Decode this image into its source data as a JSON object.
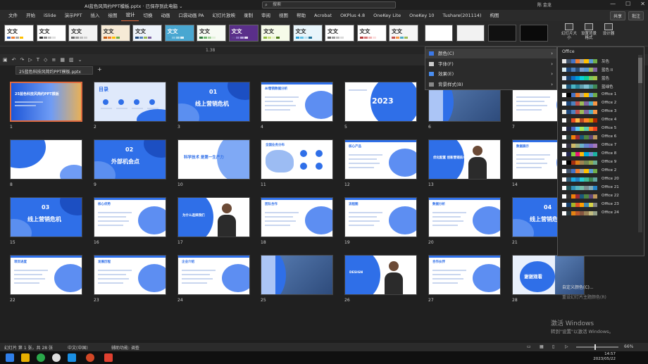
{
  "titlebar": {
    "title": "AI蓝色风简约PPT模板.pptx · 已保存到此电脑 ⌄",
    "search_placeholder": "搜索",
    "user": "陈 金龙",
    "min": "—",
    "max": "☐",
    "close": "✕"
  },
  "menu": {
    "items": [
      "文件",
      "开始",
      "iSlide",
      "演示PPT",
      "插入",
      "绘图",
      "设计",
      "切换",
      "动画",
      "口袋动画 PA",
      "幻灯片放映",
      "录制",
      "审阅",
      "视图",
      "帮助",
      "Acrobat",
      "OKPlus 4.8",
      "OneKey Lite",
      "OneKey 10",
      "Tushare(201114)",
      "构图"
    ],
    "active_index": 6,
    "share": "共享",
    "comment": "批注"
  },
  "ribbon": {
    "theme_label": "文文",
    "btn_size": "幻灯片大小",
    "btn_format": "设置背景格式",
    "btn_designer": "设计器"
  },
  "ruler": {
    "label": "1.38"
  },
  "doc_tab": "25蓝色科技风简约PPT模板.pptx",
  "theme_menu": {
    "items": [
      {
        "label": "颜色(C)",
        "color": "#3b78e7"
      },
      {
        "label": "字体(F)",
        "color": "#cccccc"
      },
      {
        "label": "效果(E)",
        "color": "#4a8ef0"
      },
      {
        "label": "背景样式(B)",
        "color": "#888888"
      }
    ]
  },
  "color_panel": {
    "header": "Office",
    "rows": [
      {
        "name": "灰色",
        "colors": [
          "#e7e6e6",
          "#44546a",
          "#4472c4",
          "#ed7d31",
          "#a5a5a5",
          "#ffc000",
          "#5b9bd5",
          "#70ad47"
        ]
      },
      {
        "name": "蓝色 II",
        "colors": [
          "#dbeef4",
          "#1f497d",
          "#4f81bd",
          "#2c4d75",
          "#7ba0cd",
          "#5b9bd5",
          "#9bbb59",
          "#8064a2"
        ]
      },
      {
        "name": "蓝色",
        "colors": [
          "#dde8f5",
          "#17406d",
          "#0f6fc6",
          "#009dd9",
          "#0bd0d9",
          "#10cf9b",
          "#7cca62",
          "#a5c249"
        ]
      },
      {
        "name": "蓝绿色",
        "colors": [
          "#e5f5f3",
          "#1b587c",
          "#4ab5c4",
          "#29859c",
          "#5f9eac",
          "#80c1d1",
          "#4d9ca3",
          "#3e8853"
        ]
      },
      {
        "name": "Office 1",
        "colors": [
          "#ffffff",
          "#000000",
          "#4472c4",
          "#ed7d31",
          "#a5a5a5",
          "#ffc000",
          "#5b9bd5",
          "#70ad47"
        ]
      },
      {
        "name": "Office 2",
        "colors": [
          "#ffffff",
          "#1f497d",
          "#4f81bd",
          "#c0504d",
          "#9bbb59",
          "#8064a2",
          "#4bacc6",
          "#f79646"
        ]
      },
      {
        "name": "Office 3",
        "colors": [
          "#eeece1",
          "#1f497d",
          "#4f81bd",
          "#c0504d",
          "#9bbb59",
          "#8064a2",
          "#4bacc6",
          "#f79646"
        ]
      },
      {
        "name": "Office 4",
        "colors": [
          "#ffffff",
          "#2e2e2e",
          "#e84c22",
          "#ffbd47",
          "#b64926",
          "#ff8427",
          "#cc9900",
          "#b22600"
        ]
      },
      {
        "name": "Office 5",
        "colors": [
          "#ffffff",
          "#212745",
          "#4e67c8",
          "#5eccf3",
          "#a7ea52",
          "#5dceaf",
          "#ff8021",
          "#f14124"
        ]
      },
      {
        "name": "Office 6",
        "colors": [
          "#ffffff",
          "#2a3d3c",
          "#f07f09",
          "#9f2936",
          "#1b587c",
          "#4e8542",
          "#604878",
          "#c19859"
        ]
      },
      {
        "name": "Office 7",
        "colors": [
          "#ffffff",
          "#373545",
          "#ceb966",
          "#9cb084",
          "#6bb1c9",
          "#6585cf",
          "#7e6bc9",
          "#a379bb"
        ]
      },
      {
        "name": "Office 8",
        "colors": [
          "#ffffff",
          "#242852",
          "#7fd13b",
          "#ea157a",
          "#feb80a",
          "#00addc",
          "#738ac8",
          "#1ab39f"
        ]
      },
      {
        "name": "Office 9",
        "colors": [
          "#ffffff",
          "#000000",
          "#a53010",
          "#de7e18",
          "#9f8351",
          "#728653",
          "#92aa4c",
          "#6aac91"
        ]
      },
      {
        "name": "Office 2",
        "colors": [
          "#ffffff",
          "#44546a",
          "#4472c4",
          "#ed7d31",
          "#a5a5a5",
          "#ffc000",
          "#5b9bd5",
          "#70ad47"
        ]
      },
      {
        "name": "Office 20",
        "colors": [
          "#ffffff",
          "#335b74",
          "#1cade4",
          "#2683c6",
          "#27ced7",
          "#42ba97",
          "#3e8853",
          "#62a39f"
        ]
      },
      {
        "name": "Office 21",
        "colors": [
          "#ffffff",
          "#1e5155",
          "#3494ba",
          "#58b6c0",
          "#75bda7",
          "#7a8c8e",
          "#84acb6",
          "#2683c6"
        ]
      },
      {
        "name": "Office 22",
        "colors": [
          "#ffffff",
          "#303030",
          "#f07f09",
          "#9f2936",
          "#1b587c",
          "#4e8542",
          "#604878",
          "#c19859"
        ]
      },
      {
        "name": "Office 23",
        "colors": [
          "#ffffff",
          "#17406d",
          "#a6b727",
          "#df5327",
          "#fe9e00",
          "#418ab3",
          "#d7d447",
          "#818183"
        ]
      },
      {
        "name": "Office 24",
        "colors": [
          "#ffffff",
          "#2c3c43",
          "#e48312",
          "#bd582c",
          "#865640",
          "#9b8357",
          "#c2bc80",
          "#94a088"
        ]
      }
    ],
    "custom": "自定义颜色(C)...",
    "reset": "重设幻灯片主题颜色(R)"
  },
  "slides": [
    {
      "n": "1",
      "kind": "cover",
      "title": "25蓝色科技风简约PPT模板"
    },
    {
      "n": "2",
      "kind": "toc",
      "title": "目录"
    },
    {
      "n": "3",
      "kind": "section",
      "num": "01",
      "title": "线上营销危机"
    },
    {
      "n": "4",
      "kind": "content",
      "title": "AI营销数据分析"
    },
    {
      "n": "5",
      "kind": "big",
      "title": "2023"
    },
    {
      "n": "6",
      "kind": "photo",
      "title": ""
    },
    {
      "n": "7",
      "kind": "content",
      "title": "AI营销数据"
    },
    {
      "n": "8",
      "kind": "blob",
      "title": ""
    },
    {
      "n": "9",
      "kind": "section",
      "num": "02",
      "title": "外部机会点"
    },
    {
      "n": "10",
      "kind": "quote",
      "title": "科学技术 是第一生产力"
    },
    {
      "n": "11",
      "kind": "map",
      "title": "全国业务分布"
    },
    {
      "n": "12",
      "kind": "content",
      "title": "核心产品"
    },
    {
      "n": "13",
      "kind": "person",
      "title": "优化配置 创新营销技术"
    },
    {
      "n": "14",
      "kind": "content",
      "title": "数据展示"
    },
    {
      "n": "15",
      "kind": "section",
      "num": "03",
      "title": "线上营销危机"
    },
    {
      "n": "16",
      "kind": "content",
      "title": "核心优势"
    },
    {
      "n": "17",
      "kind": "person",
      "title": "为什么选择我们"
    },
    {
      "n": "18",
      "kind": "content",
      "title": "团队合作"
    },
    {
      "n": "19",
      "kind": "content",
      "title": "流程图"
    },
    {
      "n": "20",
      "kind": "content",
      "title": "数据分析"
    },
    {
      "n": "21",
      "kind": "section",
      "num": "04",
      "title": "线上营销危机"
    },
    {
      "n": "22",
      "kind": "content",
      "title": "项目进度"
    },
    {
      "n": "23",
      "kind": "content",
      "title": "发展历程"
    },
    {
      "n": "24",
      "kind": "content",
      "title": "企业介绍"
    },
    {
      "n": "25",
      "kind": "photo",
      "title": ""
    },
    {
      "n": "26",
      "kind": "person",
      "title": "DESIGN"
    },
    {
      "n": "27",
      "kind": "content",
      "title": "合作伙伴"
    },
    {
      "n": "28",
      "kind": "end",
      "title": "谢谢观看"
    }
  ],
  "watermark": {
    "line1": "激活 Windows",
    "line2": "转到\"设置\"以激活 Windows。"
  },
  "status": {
    "left": "幻灯片 第 1 张，共 28 张",
    "lang": "中文(中国)",
    "access": "辅助功能: 调查",
    "zoom": "66%"
  },
  "clock": {
    "time": "14:57",
    "date": "2023/05/22"
  }
}
